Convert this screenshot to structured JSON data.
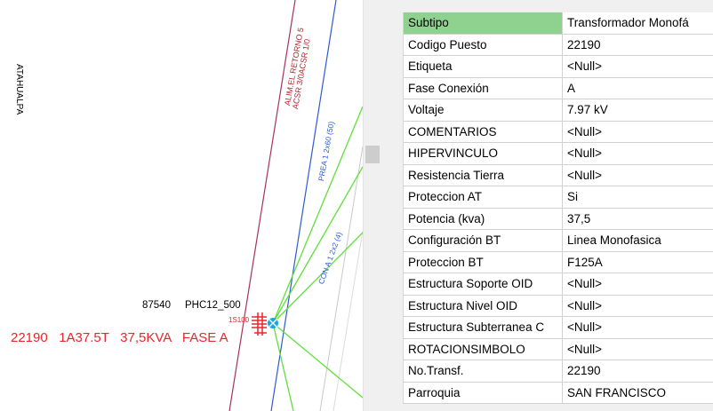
{
  "map": {
    "street_label": "ATAHUALPA",
    "red_line_label_1": "ALIM.EL RETORNO 5",
    "red_line_label_2": "ACSR 3/0ACSR 1/0",
    "blue_line_label": "PREA 1 2x60 (50)",
    "green_line_label": "CON A 1 2x2 (4)",
    "point_label_1": "87540",
    "point_label_2": "PHC12_500",
    "transformer_code": "1S100",
    "transformer_annotation": "22190   1A37.5T   37,5KVA   FASE A"
  },
  "properties": [
    {
      "label": "Subtipo",
      "value": "Transformador Monofá"
    },
    {
      "label": "Codigo Puesto",
      "value": "22190"
    },
    {
      "label": "Etiqueta",
      "value": "<Null>"
    },
    {
      "label": "Fase Conexión",
      "value": "A"
    },
    {
      "label": "Voltaje",
      "value": "7.97 kV"
    },
    {
      "label": "COMENTARIOS",
      "value": "<Null>"
    },
    {
      "label": "HIPERVINCULO",
      "value": "<Null>"
    },
    {
      "label": "Resistencia Tierra",
      "value": "<Null>"
    },
    {
      "label": "Proteccion AT",
      "value": "Si"
    },
    {
      "label": "Potencia (kva)",
      "value": "37,5"
    },
    {
      "label": "Configuración BT",
      "value": "Linea Monofasica"
    },
    {
      "label": "Proteccion BT",
      "value": "F125A"
    },
    {
      "label": "Estructura Soporte OID",
      "value": "<Null>"
    },
    {
      "label": "Estructura Nivel OID",
      "value": "<Null>"
    },
    {
      "label": "Estructura Subterranea C",
      "value": "<Null>"
    },
    {
      "label": "ROTACIONSIMBOLO",
      "value": "<Null>"
    },
    {
      "label": "No.Transf.",
      "value": "22190"
    },
    {
      "label": "Parroquia",
      "value": "SAN FRANCISCO"
    }
  ],
  "colors": {
    "selected_row": "#8fd18f",
    "annotation_red": "#e8262b",
    "line_red": "#a8325a",
    "line_blue": "#2d5bd1",
    "line_green": "#5fe03a",
    "transformer_cyan": "#19a6e0"
  }
}
